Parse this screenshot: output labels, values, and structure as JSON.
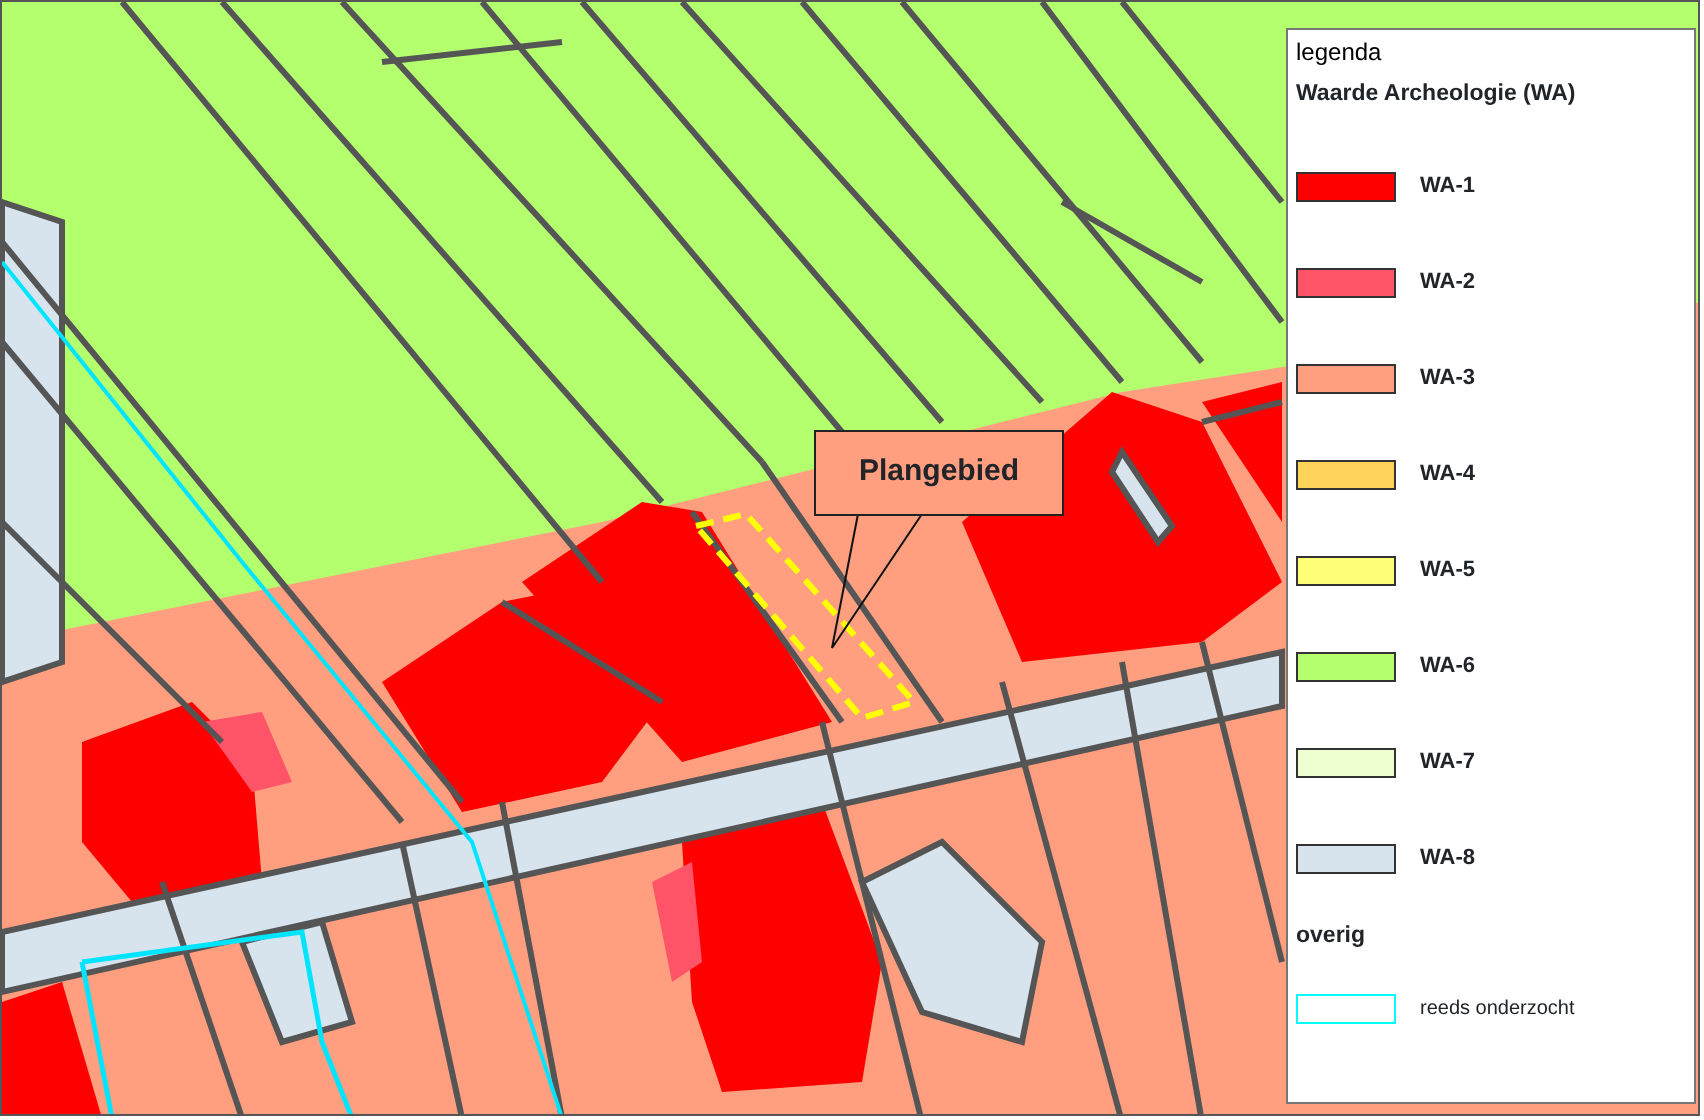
{
  "map": {
    "callout": "Plangebied"
  },
  "legend": {
    "title": "legenda",
    "groups": [
      {
        "heading": "Waarde Archeologie (WA)",
        "items": [
          {
            "label": "WA-1",
            "color": "#ff0000",
            "kind": "fill"
          },
          {
            "label": "WA-2",
            "color": "#ff5468",
            "kind": "fill"
          },
          {
            "label": "WA-3",
            "color": "#ff9f80",
            "kind": "fill"
          },
          {
            "label": "WA-4",
            "color": "#ffd25a",
            "kind": "fill"
          },
          {
            "label": "WA-5",
            "color": "#ffff78",
            "kind": "fill"
          },
          {
            "label": "WA-6",
            "color": "#b4ff6e",
            "kind": "fill"
          },
          {
            "label": "WA-7",
            "color": "#eeffd2",
            "kind": "fill"
          },
          {
            "label": "WA-8",
            "color": "#d7e4ee",
            "kind": "fill"
          }
        ]
      },
      {
        "heading": "overig",
        "items": [
          {
            "label": "reeds onderzocht",
            "color": "#00ffff",
            "kind": "outline"
          }
        ]
      }
    ]
  }
}
